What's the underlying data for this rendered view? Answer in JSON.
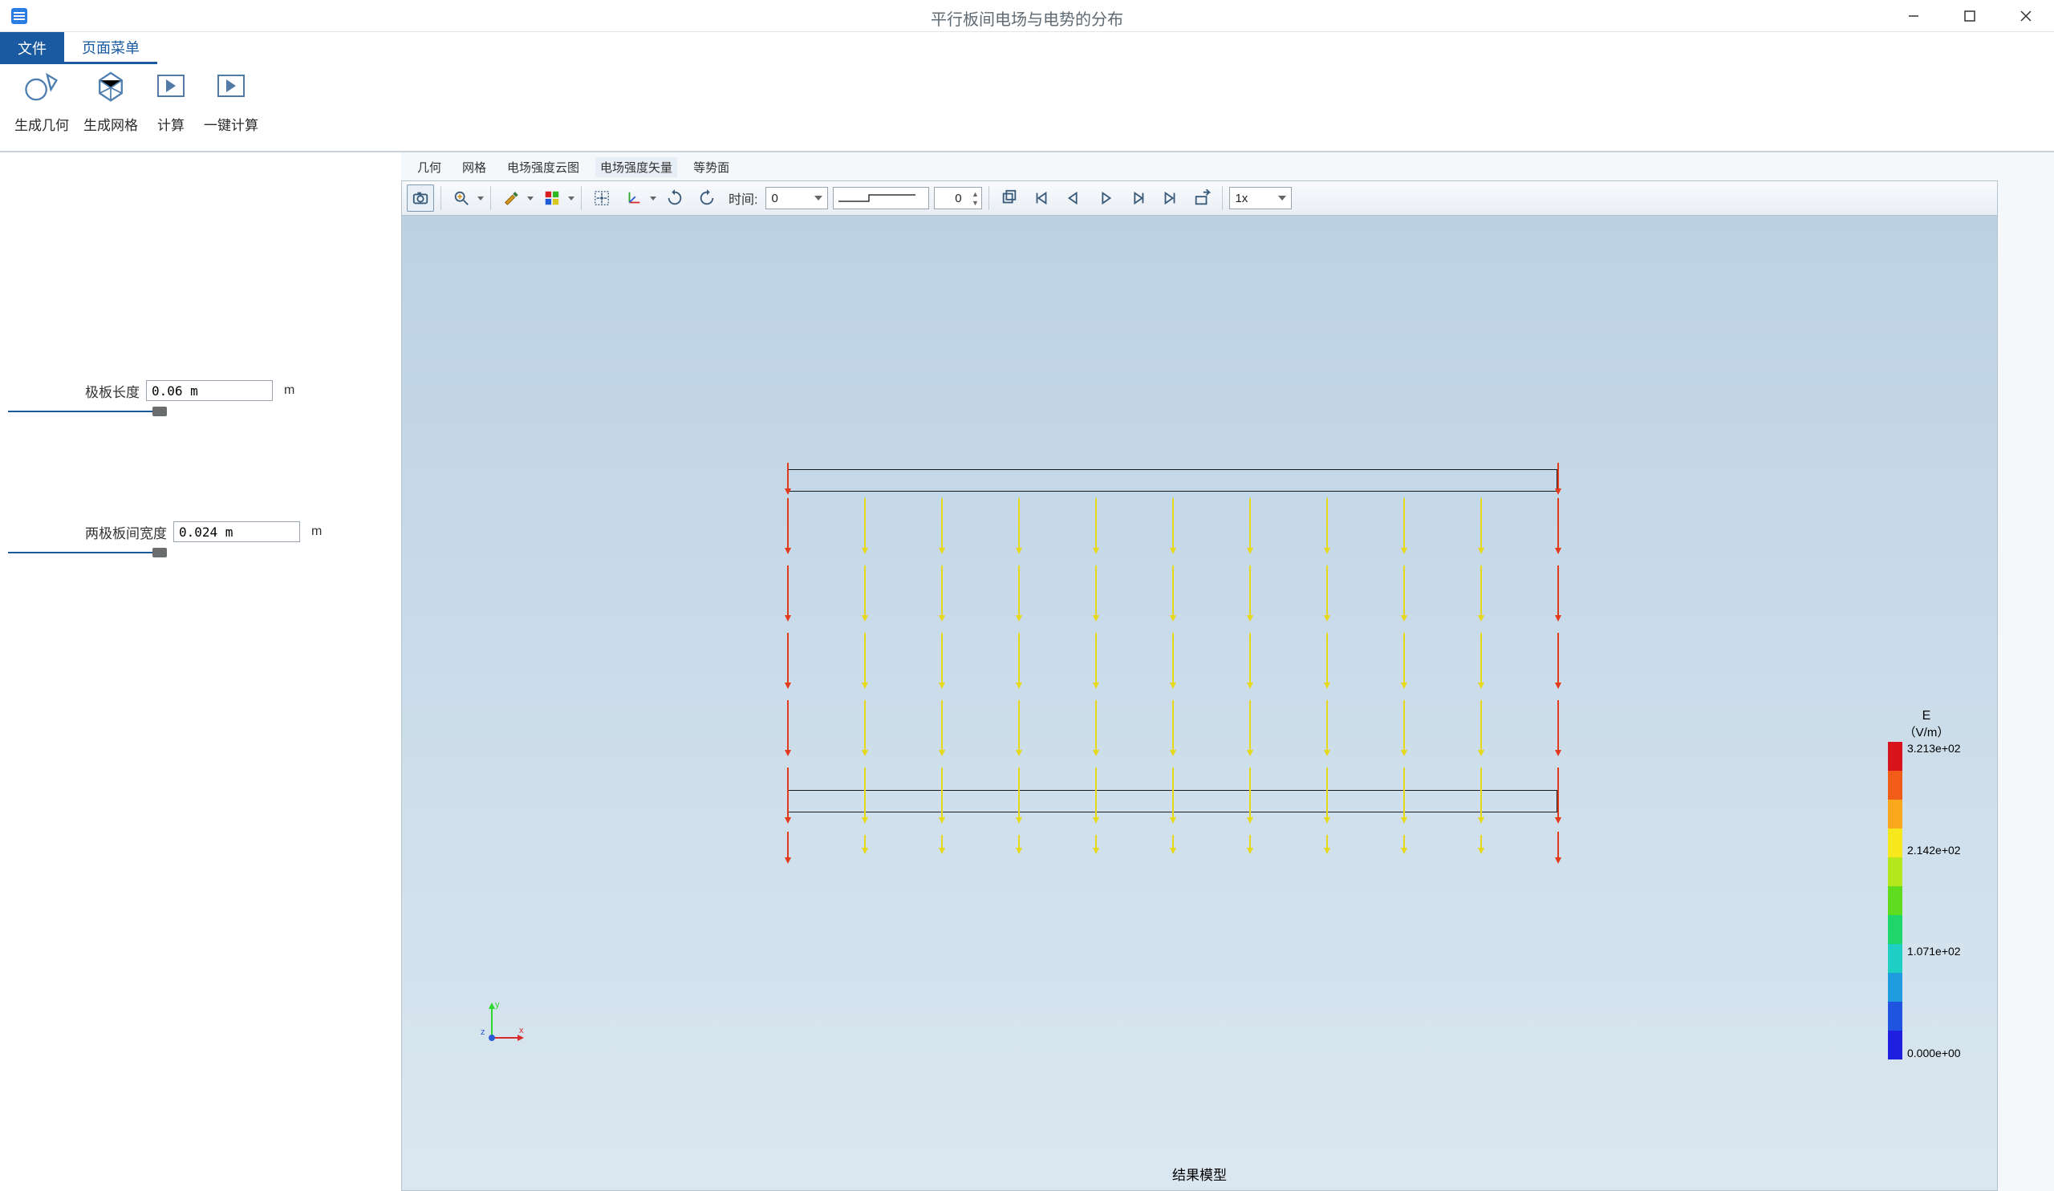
{
  "title": "平行板间电场与电势的分布",
  "menu": {
    "file": "文件",
    "page": "页面菜单"
  },
  "ribbon": {
    "gen_geometry": "生成几何",
    "gen_mesh": "生成网格",
    "compute": "计算",
    "one_key_compute": "一键计算"
  },
  "sidebar": {
    "plate_length": {
      "label": "极板长度",
      "value": "0.06 m",
      "unit": "m",
      "fill_pct": 60
    },
    "plate_gap": {
      "label": "两极板间宽度",
      "value": "0.024 m",
      "unit": "m",
      "fill_pct": 60
    }
  },
  "view_tabs": {
    "geometry": "几何",
    "mesh": "网格",
    "cloud": "电场强度云图",
    "vector": "电场强度矢量",
    "contour": "等势面"
  },
  "toolbar": {
    "time_label": "时间:",
    "time_value": "0",
    "frame_value": "0",
    "speed": "1x",
    "icons": {
      "camera": "camera-icon",
      "zoom": "zoom-icon",
      "brush": "brush-icon",
      "palette": "palette-icon",
      "fit": "fit-icon",
      "axes": "axes-icon",
      "rotate_cw": "rotate-cw-icon",
      "rotate_ccw": "rotate-ccw-icon",
      "crop": "crop-icon",
      "first": "first-icon",
      "prev": "prev-icon",
      "play": "play-icon",
      "next": "next-icon",
      "last": "last-icon",
      "export": "export-icon"
    }
  },
  "viewport": {
    "footer": "结果模型",
    "triad": {
      "x": "x",
      "y": "y",
      "z": "z"
    }
  },
  "legend": {
    "title": "E",
    "unit": "（V/m）",
    "labels": [
      "3.213e+02",
      "2.142e+02",
      "1.071e+02",
      "0.000e+00"
    ],
    "colors": [
      "#d8131b",
      "#f25c19",
      "#fba81c",
      "#f7e81e",
      "#b6e61c",
      "#5fdc1e",
      "#1fd66a",
      "#1fcfc3",
      "#1f9be0",
      "#1f54e0",
      "#1f1fe0"
    ]
  },
  "field": {
    "columns": 11,
    "rows": 5,
    "interior_color": "#e6d81a",
    "edge_color": "#e23a1a"
  }
}
